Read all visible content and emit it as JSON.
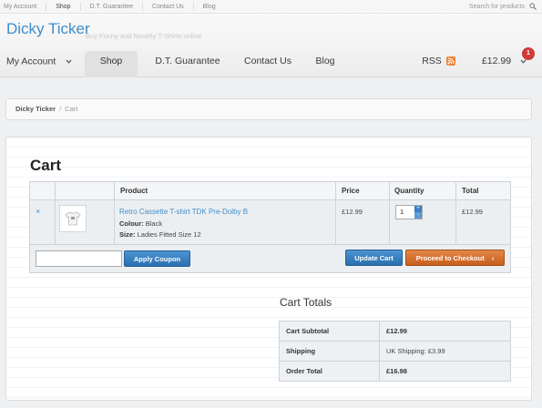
{
  "topbar": {
    "links": [
      "My Account",
      "Shop",
      "D.T. Guarantee",
      "Contact Us",
      "Blog"
    ],
    "search_placeholder": "Search for products"
  },
  "site": {
    "name": "Dicky Ticker",
    "tagline": "Buy Funny and Novelty T-Shirts online"
  },
  "nav": {
    "my_account": "My Account",
    "shop": "Shop",
    "guarantee": "D.T. Guarantee",
    "contact": "Contact Us",
    "blog": "Blog",
    "rss": "RSS",
    "cart_total": "£12.99",
    "cart_count": "1"
  },
  "breadcrumb": {
    "home": "Dicky Ticker",
    "separator": "/",
    "current": "Cart"
  },
  "cart": {
    "title": "Cart",
    "headers": {
      "product": "Product",
      "price": "Price",
      "quantity": "Quantity",
      "total": "Total"
    },
    "item": {
      "remove": "×",
      "name": "Retro Cassette T-shirt TDK Pre-Dolby B",
      "colour_label": "Colour:",
      "colour": "Black",
      "size_label": "Size:",
      "size": "Ladies Fitted Size 12",
      "price": "£12.99",
      "quantity": "1",
      "total": "£12.99"
    },
    "coupon_value": "",
    "apply_coupon": "Apply Coupon",
    "update_cart": "Update Cart",
    "checkout": "Proceed to Checkout",
    "checkout_arrow": "›"
  },
  "totals": {
    "title": "Cart Totals",
    "rows": [
      {
        "label": "Cart Subtotal",
        "value": "£12.99"
      },
      {
        "label": "Shipping",
        "value": "UK Shipping: £3.99"
      },
      {
        "label": "Order Total",
        "value": "£16.98"
      }
    ]
  },
  "colors": {
    "link": "#3f8ecb",
    "button_blue": "#2c6fae",
    "button_orange": "#c85e1c",
    "rss": "#f0833a",
    "badge": "#cf3a3a"
  },
  "icons": [
    "search-icon",
    "chevron-down-icon",
    "rss-icon",
    "tshirt-icon",
    "remove-icon"
  ]
}
